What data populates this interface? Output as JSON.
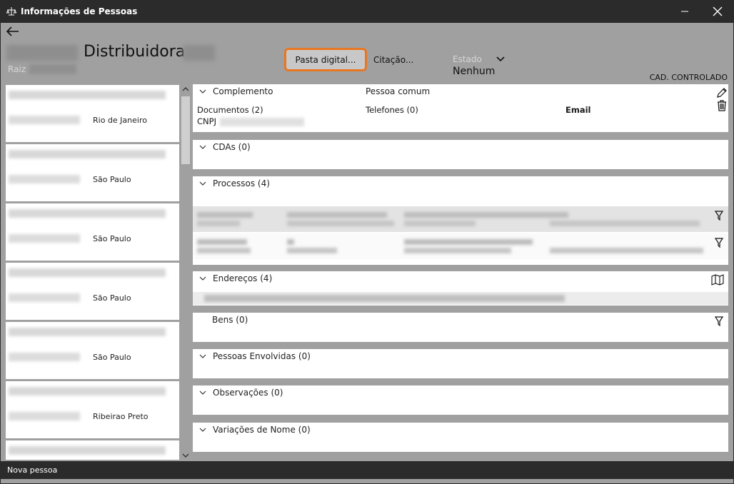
{
  "window": {
    "title": "Informações de Pessoas",
    "icons": {
      "app": "scale-icon",
      "minimize": "minimize-icon",
      "close": "close-icon"
    }
  },
  "header": {
    "title": "Distribuidora",
    "raiz_label": "Raiz",
    "pasta_button": "Pasta digital...",
    "citacao_button": "Citação...",
    "estado_label": "Estado",
    "estado_value": "Nenhum",
    "cad_label": "CAD. CONTROLADO",
    "accent_color": "#e87722"
  },
  "list": {
    "items": [
      {
        "city": "Rio de Janeiro"
      },
      {
        "city": "São Paulo"
      },
      {
        "city": "São Paulo"
      },
      {
        "city": "São Paulo"
      },
      {
        "city": "São Paulo"
      },
      {
        "city": "Ribeirao Preto"
      },
      {
        "city": ""
      }
    ]
  },
  "sections": {
    "complemento": {
      "label": "Complemento",
      "pessoa": "Pessoa comum",
      "documentos": "Documentos (2)",
      "telefones": "Telefones (0)",
      "email": "Email",
      "cnpj": "CNPJ"
    },
    "cdas": {
      "label": "CDAs (0)"
    },
    "processos": {
      "label": "Processos (4)"
    },
    "enderecos": {
      "label": "Endereços (4)"
    },
    "bens": {
      "label": "Bens (0)"
    },
    "pessoas_envolvidas": {
      "label": "Pessoas Envolvidas (0)"
    },
    "observacoes": {
      "label": "Observações (0)"
    },
    "variacoes": {
      "label": "Variações de Nome (0)"
    }
  },
  "statusbar": {
    "text": "Nova pessoa"
  }
}
